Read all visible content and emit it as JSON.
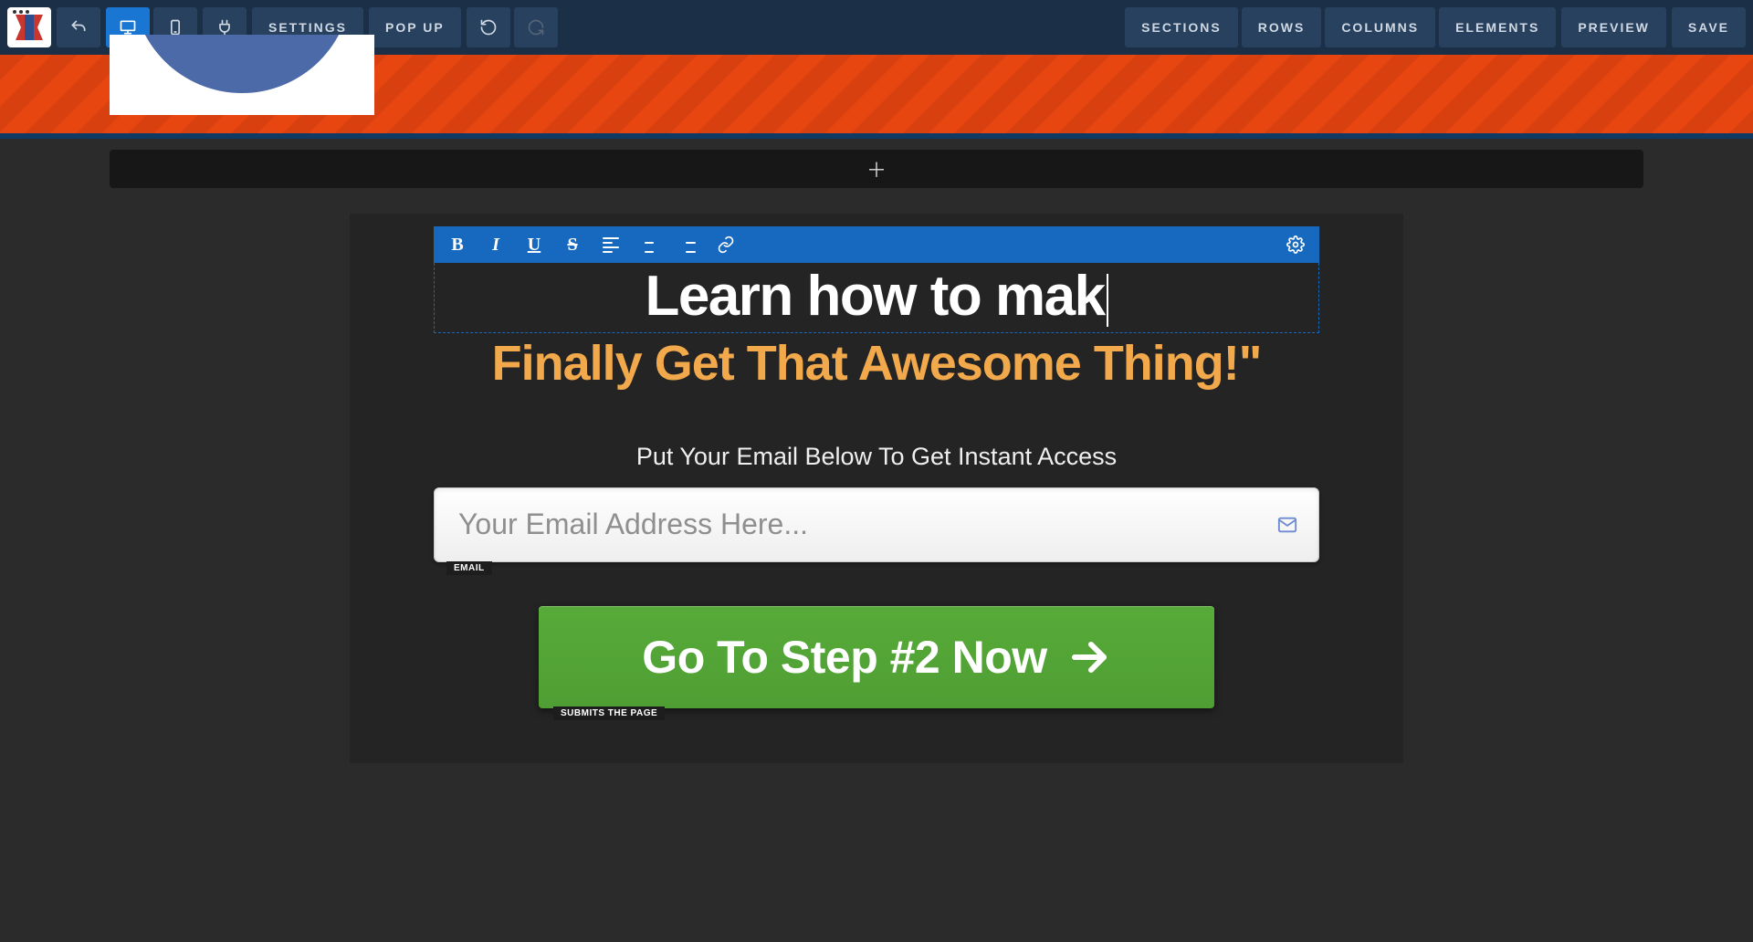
{
  "appbar": {
    "settings": "SETTINGS",
    "popup": "POP UP",
    "sections": "SECTIONS",
    "rows": "ROWS",
    "columns": "COLUMNS",
    "elements": "ELEMENTS",
    "preview": "PREVIEW",
    "save": "SAVE"
  },
  "canvas": {
    "headline_editing": "Learn how to mak",
    "sub_headline": "Finally Get That Awesome Thing!\"",
    "lead": "Put Your Email Below To Get Instant Access",
    "email_placeholder": "Your Email Address Here...",
    "email_tag": "EMAIL",
    "cta_label": "Go To Step #2 Now",
    "cta_tag": "SUBMITS THE PAGE"
  }
}
